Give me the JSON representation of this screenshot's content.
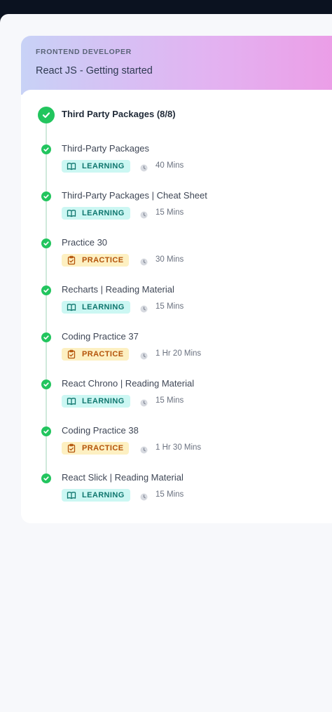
{
  "course": {
    "track": "FRONTEND DEVELOPER",
    "title": "React JS - Getting started"
  },
  "module": {
    "title": "Third Party Packages (8/8)"
  },
  "colors": {
    "success": "#22c55e",
    "learning_bg": "#ccf7f3",
    "learning_text": "#0f766e",
    "practice_bg": "#fdf0c2",
    "practice_text": "#b45309"
  },
  "items": [
    {
      "title": "Third-Party Packages",
      "type": "LEARNING",
      "duration": "40 Mins"
    },
    {
      "title": "Third-Party Packages | Cheat Sheet",
      "type": "LEARNING",
      "duration": "15 Mins"
    },
    {
      "title": "Practice 30",
      "type": "PRACTICE",
      "duration": "30 Mins"
    },
    {
      "title": "Recharts | Reading Material",
      "type": "LEARNING",
      "duration": "15 Mins"
    },
    {
      "title": "Coding Practice 37",
      "type": "PRACTICE",
      "duration": "1 Hr 20 Mins"
    },
    {
      "title": "React Chrono | Reading Material",
      "type": "LEARNING",
      "duration": "15 Mins"
    },
    {
      "title": "Coding Practice 38",
      "type": "PRACTICE",
      "duration": "1 Hr 30 Mins"
    },
    {
      "title": "React Slick | Reading Material",
      "type": "LEARNING",
      "duration": "15 Mins"
    }
  ]
}
